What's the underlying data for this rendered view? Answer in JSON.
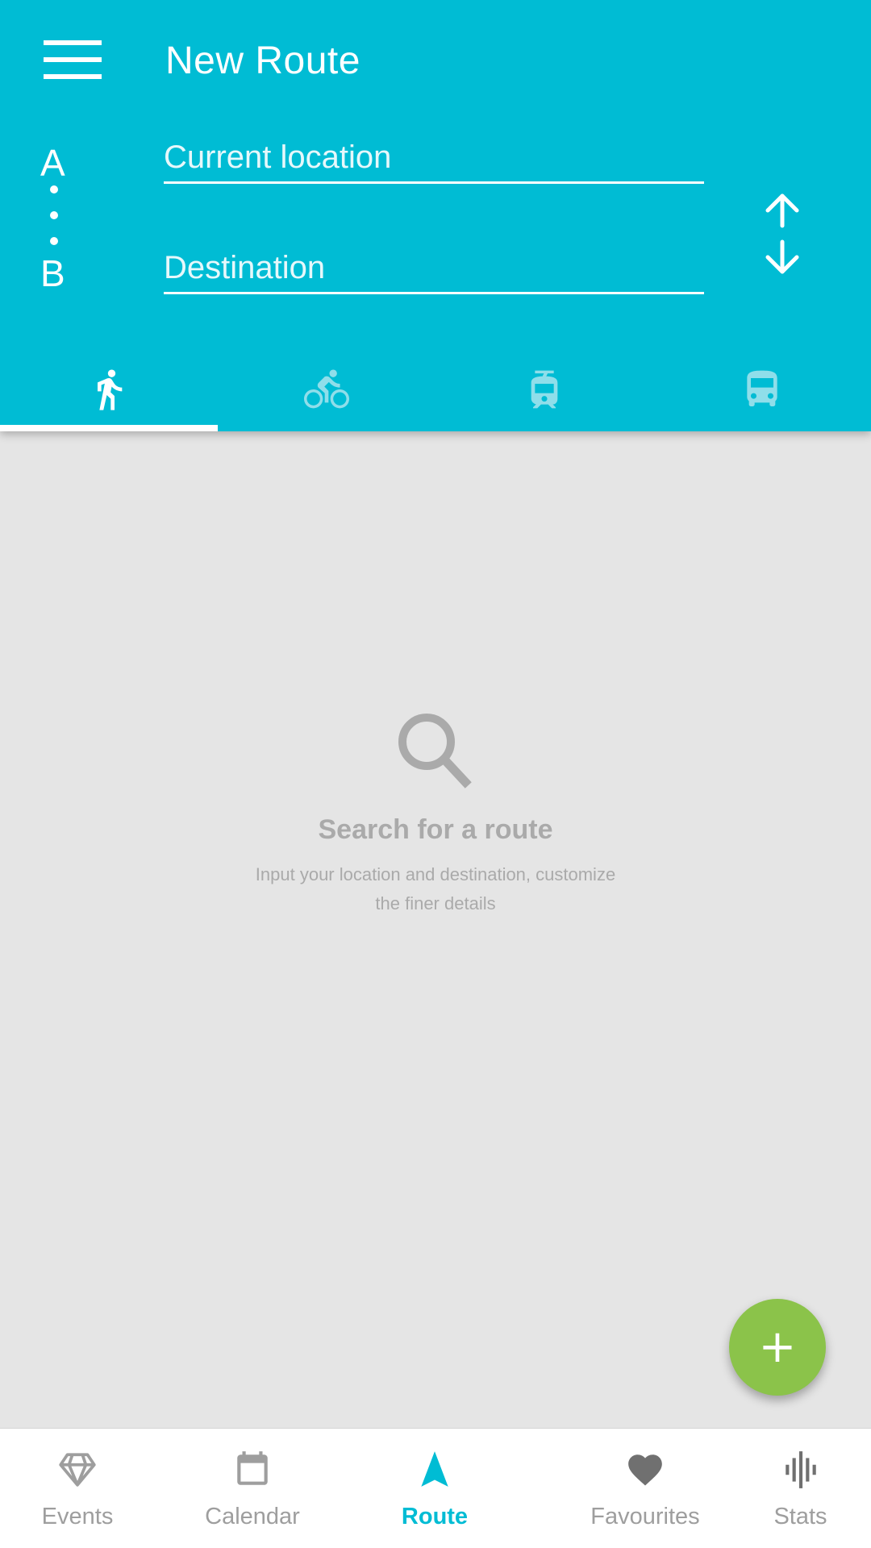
{
  "header": {
    "title": "New Route",
    "point_a": "A",
    "point_b": "B",
    "origin_placeholder": "Current location",
    "destination_placeholder": "Destination"
  },
  "tabs": [
    {
      "name": "walk",
      "icon": "walk-icon",
      "active": true
    },
    {
      "name": "bike",
      "icon": "bike-icon",
      "active": false
    },
    {
      "name": "train",
      "icon": "train-icon",
      "active": false
    },
    {
      "name": "bus",
      "icon": "bus-icon",
      "active": false
    }
  ],
  "empty_state": {
    "icon": "search-icon",
    "title": "Search for a route",
    "subtitle": "Input your location and destination, customize the  finer details"
  },
  "fab": {
    "icon": "plus-icon"
  },
  "bottom_nav": [
    {
      "label": "Events",
      "icon": "diamond-icon",
      "active": false
    },
    {
      "label": "Calendar",
      "icon": "calendar-icon",
      "active": false
    },
    {
      "label": "Route",
      "icon": "navigation-arrow-icon",
      "active": true
    },
    {
      "label": "Favourites",
      "icon": "heart-icon",
      "active": false
    },
    {
      "label": "Stats",
      "icon": "stats-icon",
      "active": false
    }
  ],
  "colors": {
    "primary": "#00bcd4",
    "accent": "#8bc34a",
    "background": "#e5e5e5",
    "inactive": "#9e9e9e"
  }
}
